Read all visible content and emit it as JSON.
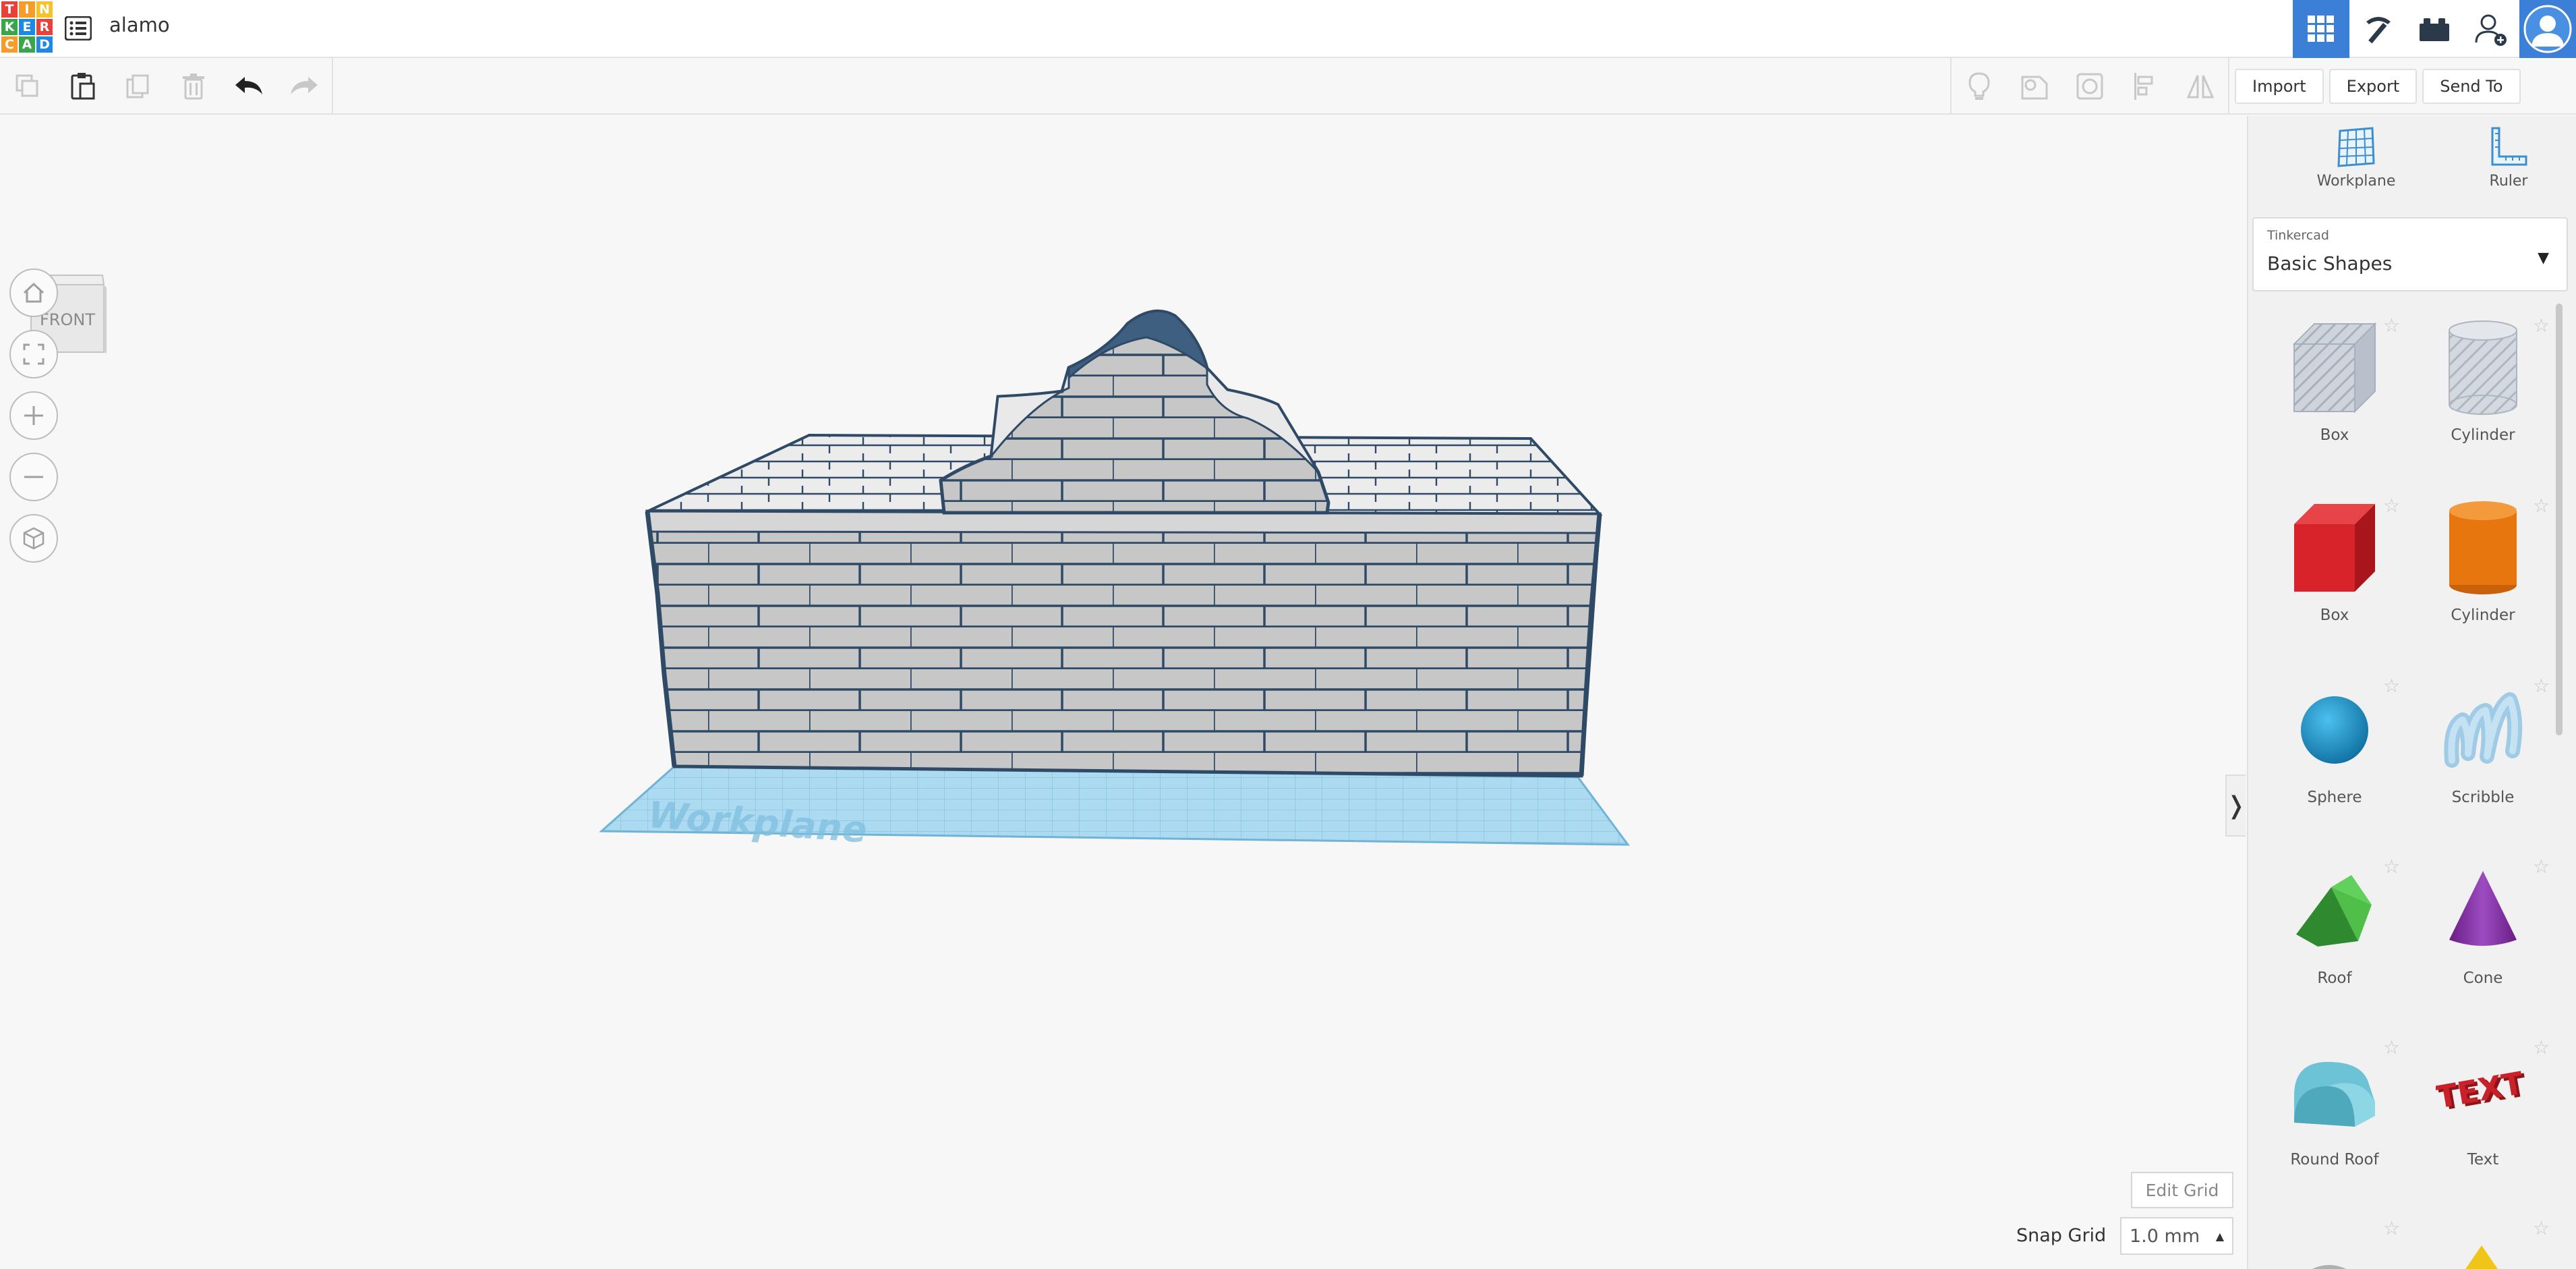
{
  "app": {
    "logo_letters": [
      "T",
      "I",
      "N",
      "K",
      "E",
      "R",
      "C",
      "A",
      "D"
    ],
    "logo_colors": [
      "#e8413a",
      "#f59d2a",
      "#f5c22a",
      "#3aa54b",
      "#1e88e5",
      "#e8413a",
      "#f59d2a",
      "#3aa54b",
      "#1e88e5"
    ],
    "design_title": "alamo"
  },
  "top_nav": {
    "items": [
      {
        "name": "3d-design-view",
        "icon": "grid-icon",
        "active": true
      },
      {
        "name": "build-view",
        "icon": "pickaxe-icon",
        "active": false
      },
      {
        "name": "bricks-view",
        "icon": "brick-icon",
        "active": false
      },
      {
        "name": "add-user",
        "icon": "add-user-icon",
        "active": false
      },
      {
        "name": "profile",
        "icon": "avatar-icon",
        "active": false
      }
    ]
  },
  "toolbar": {
    "left_icons": [
      "copy-icon",
      "paste-icon",
      "duplicate-icon",
      "delete-icon",
      "undo-icon",
      "redo-icon"
    ],
    "right_icons": [
      "light-icon",
      "shape-note-icon",
      "group-icon",
      "align-icon",
      "mirror-icon"
    ],
    "import_label": "Import",
    "export_label": "Export",
    "send_to_label": "Send To"
  },
  "viewport": {
    "viewcube_face": "FRONT",
    "controls": [
      "home-icon",
      "fit-view-icon",
      "zoom-in-icon",
      "zoom-out-icon",
      "perspective-icon"
    ],
    "workplane_watermark": "Workplane",
    "edit_grid_label": "Edit Grid",
    "snap_grid_label": "Snap Grid",
    "snap_grid_value": "1.0 mm",
    "collapse_glyph": "❭"
  },
  "panel": {
    "workplane_label": "Workplane",
    "ruler_label": "Ruler",
    "library_provider": "Tinkercad",
    "library_name": "Basic Shapes",
    "shapes": [
      {
        "label": "Box",
        "kind": "box-hole"
      },
      {
        "label": "Cylinder",
        "kind": "cylinder-hole"
      },
      {
        "label": "Box",
        "kind": "box"
      },
      {
        "label": "Cylinder",
        "kind": "cylinder"
      },
      {
        "label": "Sphere",
        "kind": "sphere"
      },
      {
        "label": "Scribble",
        "kind": "scribble"
      },
      {
        "label": "Roof",
        "kind": "roof"
      },
      {
        "label": "Cone",
        "kind": "cone"
      },
      {
        "label": "Round Roof",
        "kind": "round-roof"
      },
      {
        "label": "Text",
        "kind": "text"
      }
    ]
  },
  "colors": {
    "accent": "#3b7fd6",
    "workplane": "#a8d8ef",
    "wall_fill": "#c9c9c9",
    "wall_stroke": "#2f4a66",
    "box_red": "#d8232a",
    "cylinder_orange": "#e8760f",
    "sphere_blue": "#1690c9",
    "roof_green": "#3aa53a",
    "cone_purple": "#8b3aa8",
    "round_roof_teal": "#6cc3d6",
    "text_red": "#c9202a"
  }
}
